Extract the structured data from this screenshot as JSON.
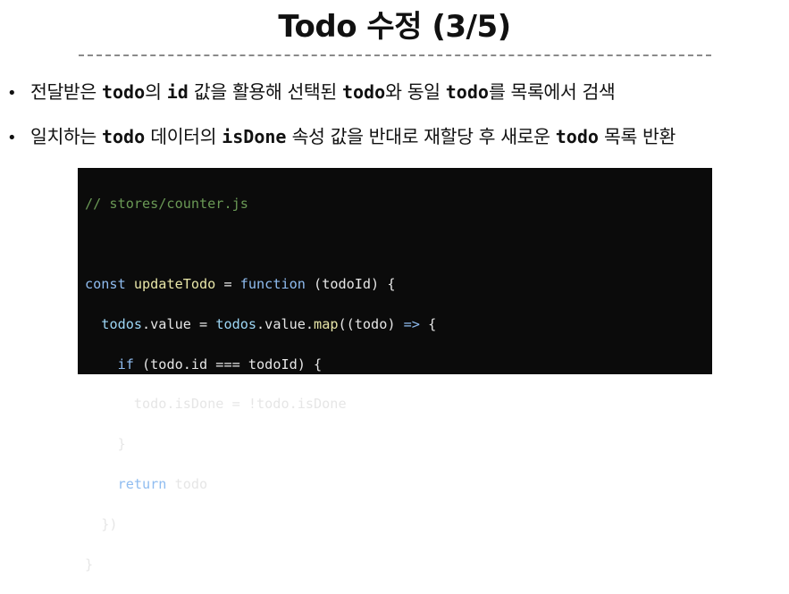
{
  "title": "Todo 수정 (3/5)",
  "bullets": [
    {
      "dot": "•",
      "parts": [
        "전달받은 ",
        "todo",
        "의 ",
        "id",
        " 값을 활용해 선택된 ",
        "todo",
        "와 동일 ",
        "todo",
        "를 목록에서 검색"
      ]
    },
    {
      "dot": "•",
      "parts": [
        "일치하는 ",
        "todo",
        " 데이터의 ",
        "isDone",
        " 속성 값을 반대로 재할당 후 새로운 ",
        "todo",
        " 목록 반환"
      ]
    }
  ],
  "code": {
    "comment": "// stores/counter.js",
    "l2_const": "const ",
    "l2_name": "updateTodo",
    "l2_eq": " = ",
    "l2_function": "function",
    "l2_params": " (todoId) {",
    "l3_indent": "  ",
    "l3_a": "todos",
    "l3_b": ".value = ",
    "l3_c": "todos",
    "l3_d": ".value.",
    "l3_map": "map",
    "l3_e": "((todo) ",
    "l3_arrow": "=>",
    "l3_f": " {",
    "l4_indent": "    ",
    "l4_if": "if",
    "l4_rest": " (todo.id === todoId) {",
    "l5": "      todo.isDone = !todo.isDone",
    "l6": "    }",
    "l7_indent": "    ",
    "l7_return": "return",
    "l7_rest": " todo",
    "l8": "  })",
    "l9": "}"
  },
  "colors": {
    "comment": "#6a9955",
    "keyword": "#8fbcf0",
    "function_name": "#e8e6a8",
    "variable": "#9cd6f5",
    "code_background": "#0b0b0b"
  }
}
